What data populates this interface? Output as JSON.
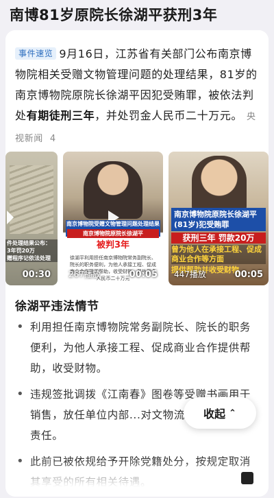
{
  "headline": "南博81岁原院长徐湖平获刑3年",
  "summary": {
    "badge": "事件速览",
    "text_before": "9月16日，江苏省有关部门公布南京博物院相关受赠文物管理问题的处理结果，81岁的南京博物院原院长徐湖平因犯受贿罪，被依法判处",
    "text_bold": "有期徒刑三年",
    "text_after": "，并处罚金人民币二十万元。",
    "source": "央视新闻",
    "count": "4"
  },
  "videos": [
    {
      "caption_lines": [
        "件处理结果公布：",
        "3年罚20万",
        "赠程序记依法处理"
      ],
      "duration": "00:30"
    },
    {
      "banner": "南京博物院受赠文物管理问题处理结果公布",
      "red_line": "南京博物院原院长徐湖平",
      "red_big": "被判3年",
      "small_text": "徐湖平利用担任南京博物院常务副院长、院长的职务便利，为他人承接工程、促成商业合作提供帮助，收受财物。并处罚金人民币二十万元",
      "plays": "267播放",
      "duration": "00:05"
    },
    {
      "banner": "南京博物院原院长徐湖平(81岁)犯受贿罪",
      "red_line": "获刑三年 罚款20万",
      "yellow1": "曾为他人在承接工程、促成商业合作等方面",
      "yellow2": "提供帮助并收受财物",
      "plays": "447播放",
      "duration": "00:05"
    }
  ],
  "section": {
    "title": "徐湖平违法情节",
    "items": [
      "利用担任南京博物院常务副院长、院长的职务便利，为他人承接工程、促成商业合作提供帮助，收受财物。",
      "违规签批调拨《江南春》图卷等受赠书画用于销售，放任单位内部...对文物流失负主要领导责任。",
      "此前已被依规给予开除党籍处分，按规定取消其享受的所有相关待遇。"
    ]
  },
  "collapse_button": {
    "label": "收起",
    "icon": "chevron-up-icon"
  }
}
